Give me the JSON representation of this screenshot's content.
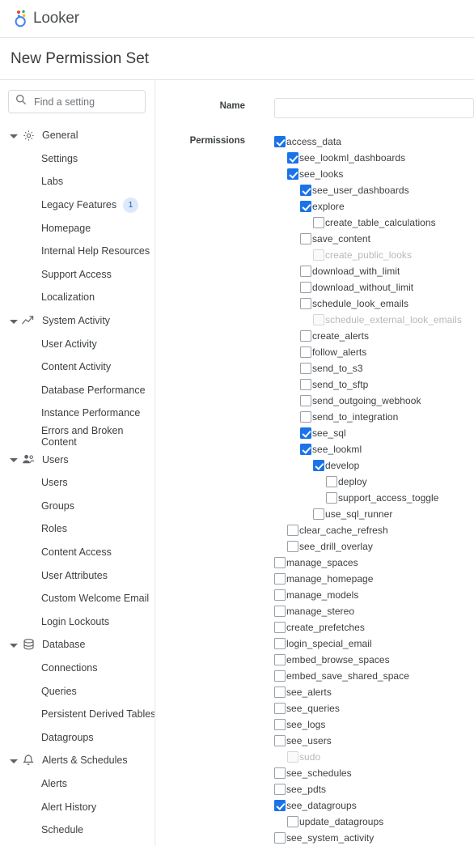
{
  "topbar": {
    "brand": "Looker",
    "logo_icon": "looker-logo-icon"
  },
  "header": {
    "title": "New Permission Set"
  },
  "sidebar": {
    "search": {
      "placeholder": "Find a setting",
      "value": "",
      "icon": "search-icon"
    },
    "groups": [
      {
        "label": "General",
        "icon": "gear-icon",
        "expanded": true,
        "items": [
          {
            "label": "Settings"
          },
          {
            "label": "Labs"
          },
          {
            "label": "Legacy Features",
            "badge": "1"
          },
          {
            "label": "Homepage"
          },
          {
            "label": "Internal Help Resources"
          },
          {
            "label": "Support Access"
          },
          {
            "label": "Localization"
          }
        ]
      },
      {
        "label": "System Activity",
        "icon": "trending-up-icon",
        "expanded": true,
        "items": [
          {
            "label": "User Activity"
          },
          {
            "label": "Content Activity"
          },
          {
            "label": "Database Performance"
          },
          {
            "label": "Instance Performance"
          },
          {
            "label": "Errors and Broken Content"
          }
        ]
      },
      {
        "label": "Users",
        "icon": "people-icon",
        "expanded": true,
        "items": [
          {
            "label": "Users"
          },
          {
            "label": "Groups"
          },
          {
            "label": "Roles"
          },
          {
            "label": "Content Access"
          },
          {
            "label": "User Attributes"
          },
          {
            "label": "Custom Welcome Email"
          },
          {
            "label": "Login Lockouts"
          }
        ]
      },
      {
        "label": "Database",
        "icon": "database-icon",
        "expanded": true,
        "items": [
          {
            "label": "Connections"
          },
          {
            "label": "Queries"
          },
          {
            "label": "Persistent Derived Tables"
          },
          {
            "label": "Datagroups"
          }
        ]
      },
      {
        "label": "Alerts & Schedules",
        "icon": "bell-icon",
        "expanded": true,
        "items": [
          {
            "label": "Alerts"
          },
          {
            "label": "Alert History"
          },
          {
            "label": "Schedule"
          }
        ]
      }
    ]
  },
  "form": {
    "name_label": "Name",
    "name_value": "",
    "permissions_label": "Permissions",
    "permissions": [
      {
        "label": "access_data",
        "level": 0,
        "checked": true,
        "disabled": false
      },
      {
        "label": "see_lookml_dashboards",
        "level": 1,
        "checked": true,
        "disabled": false
      },
      {
        "label": "see_looks",
        "level": 1,
        "checked": true,
        "disabled": false
      },
      {
        "label": "see_user_dashboards",
        "level": 2,
        "checked": true,
        "disabled": false
      },
      {
        "label": "explore",
        "level": 2,
        "checked": true,
        "disabled": false
      },
      {
        "label": "create_table_calculations",
        "level": 3,
        "checked": false,
        "disabled": false
      },
      {
        "label": "save_content",
        "level": 2,
        "checked": false,
        "disabled": false
      },
      {
        "label": "create_public_looks",
        "level": 3,
        "checked": false,
        "disabled": true
      },
      {
        "label": "download_with_limit",
        "level": 2,
        "checked": false,
        "disabled": false
      },
      {
        "label": "download_without_limit",
        "level": 2,
        "checked": false,
        "disabled": false
      },
      {
        "label": "schedule_look_emails",
        "level": 2,
        "checked": false,
        "disabled": false
      },
      {
        "label": "schedule_external_look_emails",
        "level": 3,
        "checked": false,
        "disabled": true
      },
      {
        "label": "create_alerts",
        "level": 2,
        "checked": false,
        "disabled": false
      },
      {
        "label": "follow_alerts",
        "level": 2,
        "checked": false,
        "disabled": false
      },
      {
        "label": "send_to_s3",
        "level": 2,
        "checked": false,
        "disabled": false
      },
      {
        "label": "send_to_sftp",
        "level": 2,
        "checked": false,
        "disabled": false
      },
      {
        "label": "send_outgoing_webhook",
        "level": 2,
        "checked": false,
        "disabled": false
      },
      {
        "label": "send_to_integration",
        "level": 2,
        "checked": false,
        "disabled": false
      },
      {
        "label": "see_sql",
        "level": 2,
        "checked": true,
        "disabled": false
      },
      {
        "label": "see_lookml",
        "level": 2,
        "checked": true,
        "disabled": false
      },
      {
        "label": "develop",
        "level": 3,
        "checked": true,
        "disabled": false
      },
      {
        "label": "deploy",
        "level": 4,
        "checked": false,
        "disabled": false
      },
      {
        "label": "support_access_toggle",
        "level": 4,
        "checked": false,
        "disabled": false
      },
      {
        "label": "use_sql_runner",
        "level": 3,
        "checked": false,
        "disabled": false
      },
      {
        "label": "clear_cache_refresh",
        "level": 1,
        "checked": false,
        "disabled": false
      },
      {
        "label": "see_drill_overlay",
        "level": 1,
        "checked": false,
        "disabled": false
      },
      {
        "label": "manage_spaces",
        "level": 0,
        "checked": false,
        "disabled": false
      },
      {
        "label": "manage_homepage",
        "level": 0,
        "checked": false,
        "disabled": false
      },
      {
        "label": "manage_models",
        "level": 0,
        "checked": false,
        "disabled": false
      },
      {
        "label": "manage_stereo",
        "level": 0,
        "checked": false,
        "disabled": false
      },
      {
        "label": "create_prefetches",
        "level": 0,
        "checked": false,
        "disabled": false
      },
      {
        "label": "login_special_email",
        "level": 0,
        "checked": false,
        "disabled": false
      },
      {
        "label": "embed_browse_spaces",
        "level": 0,
        "checked": false,
        "disabled": false
      },
      {
        "label": "embed_save_shared_space",
        "level": 0,
        "checked": false,
        "disabled": false
      },
      {
        "label": "see_alerts",
        "level": 0,
        "checked": false,
        "disabled": false
      },
      {
        "label": "see_queries",
        "level": 0,
        "checked": false,
        "disabled": false
      },
      {
        "label": "see_logs",
        "level": 0,
        "checked": false,
        "disabled": false
      },
      {
        "label": "see_users",
        "level": 0,
        "checked": false,
        "disabled": false
      },
      {
        "label": "sudo",
        "level": 1,
        "checked": false,
        "disabled": true
      },
      {
        "label": "see_schedules",
        "level": 0,
        "checked": false,
        "disabled": false
      },
      {
        "label": "see_pdts",
        "level": 0,
        "checked": false,
        "disabled": false
      },
      {
        "label": "see_datagroups",
        "level": 0,
        "checked": true,
        "disabled": false
      },
      {
        "label": "update_datagroups",
        "level": 1,
        "checked": false,
        "disabled": false
      },
      {
        "label": "see_system_activity",
        "level": 0,
        "checked": false,
        "disabled": false
      }
    ]
  },
  "colors": {
    "accent": "#1a73e8",
    "badge_bg": "#dce9fb",
    "badge_fg": "#1a5fb4",
    "text": "#3c4043",
    "muted": "#b4b9bd"
  }
}
